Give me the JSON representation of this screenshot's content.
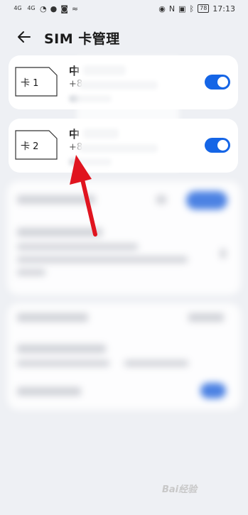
{
  "status_bar": {
    "signal_1": "4G",
    "signal_2": "4G",
    "battery": "78",
    "time": "17:13"
  },
  "header": {
    "title": "SIM 卡管理"
  },
  "sims": [
    {
      "label": "卡 1",
      "carrier": "中",
      "number_prefix": "+8",
      "enabled": true
    },
    {
      "label": "卡 2",
      "carrier": "中",
      "number_prefix": "+8",
      "enabled": true
    }
  ],
  "colors": {
    "accent": "#1565e6",
    "arrow": "#e0141f"
  },
  "watermark": "Bai经验"
}
